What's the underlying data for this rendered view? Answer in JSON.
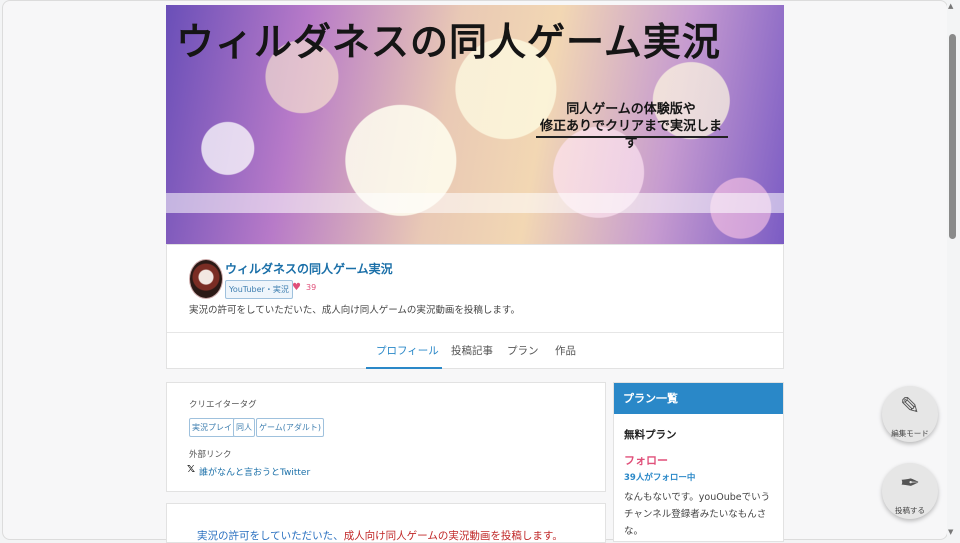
{
  "banner": {
    "title": "ウィルダネスの同人ゲーム実況",
    "subtitle_lines": [
      "同人ゲームの体験版や",
      "修正ありでクリアまで実況します"
    ]
  },
  "profile": {
    "name": "ウィルダネスの同人ゲーム実況",
    "category": "YouTuber・実況",
    "likes": "39",
    "description": "実況の許可をしていただいた、成人向け同人ゲームの実況動画を投稿します。"
  },
  "tabs": [
    "プロフィール",
    "投稿記事",
    "プラン",
    "作品"
  ],
  "creator_tags": {
    "label": "クリエイタータグ",
    "tags": [
      "実況プレイ",
      "同人",
      "ゲーム(アダルト)"
    ]
  },
  "external_links": {
    "label": "外部リンク",
    "twitter": "誰がなんと言おうとTwitter"
  },
  "body": {
    "part1": "実況の許可をしていただいた、",
    "part2": "成人向け同人ゲームの実況動画を投稿します。"
  },
  "plans": {
    "header": "プラン一覧",
    "plan_name": "無料プラン",
    "follow": "フォロー",
    "follower_count": "39人がフォロー中",
    "description": "なんもないです。youOubeでいうチャンネル登録者みたいなもんさな。"
  },
  "fab": {
    "edit_label": "編集モード",
    "post_label": "投稿する"
  },
  "colors": {
    "accent": "#2a88c8",
    "pink": "#e0507a"
  },
  "icons": {
    "edit": "edit-icon",
    "post": "post-pen-icon",
    "heart": "heart-icon",
    "x": "x-logo-icon"
  }
}
